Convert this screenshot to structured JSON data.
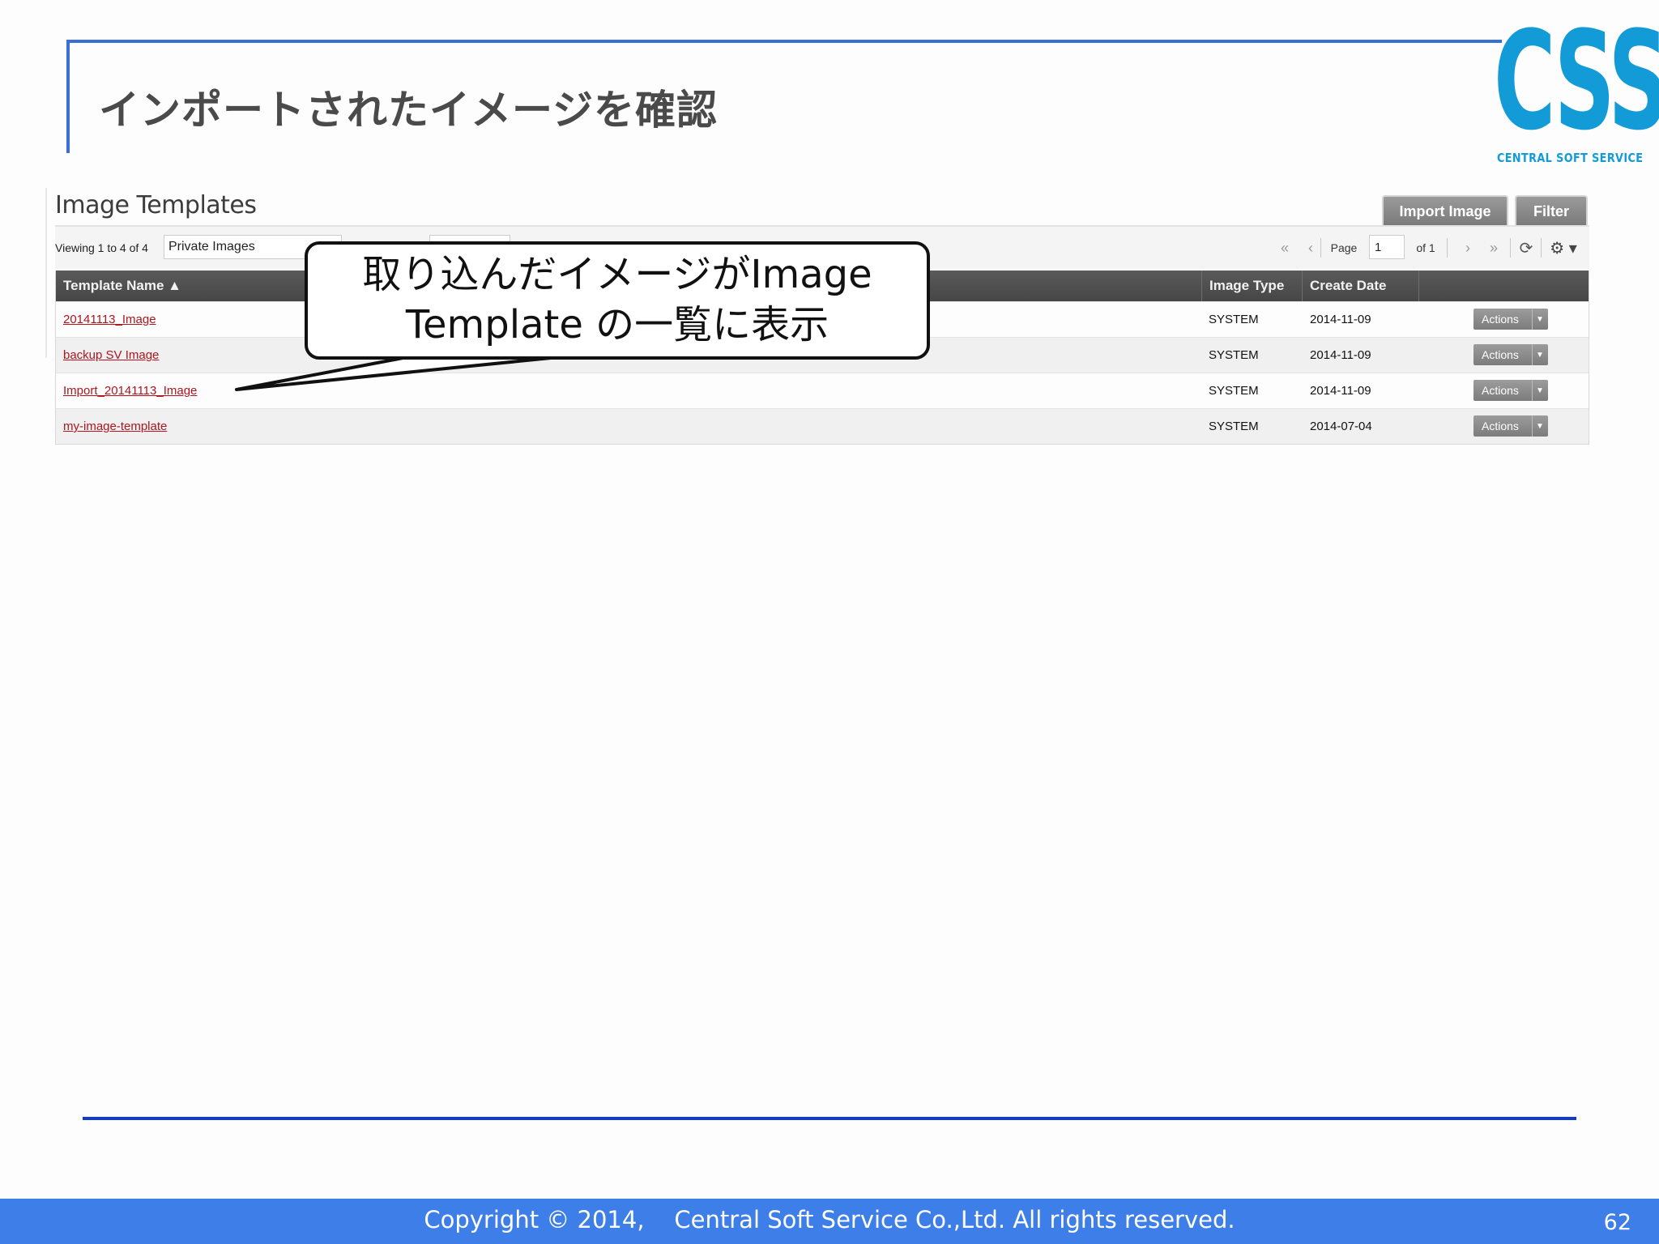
{
  "slide": {
    "title": "インポートされたイメージを確認",
    "logo_letters": "CSS",
    "logo_sub": "CENTRAL SOFT SERVICE",
    "callout_line1": "取り込んだイメージがImage",
    "callout_line2": "Template の一覧に表示",
    "copyright": "Copyright © 2014,    Central Soft Service Co.,Ltd. All rights reserved.",
    "page_number": "62"
  },
  "panel": {
    "heading": "Image Templates",
    "import_button": "Import Image",
    "filter_button": "Filter",
    "viewing_text": "Viewing 1 to 4 of 4",
    "scope_value": "Private Images",
    "pager": {
      "first_icon": "«",
      "prev_icon": "‹",
      "page_label": "Page",
      "page_value": "1",
      "of_label": "of 1",
      "next_icon": "›",
      "last_icon": "»",
      "refresh_icon": "⟳",
      "settings_icon": "⚙ ▾"
    },
    "columns": {
      "name": "Template Name ▲",
      "type": "Image Type",
      "date": "Create Date",
      "actions": ""
    },
    "rows": [
      {
        "name": "20141113_Image",
        "type": "SYSTEM",
        "date": "2014-11-09",
        "action": "Actions"
      },
      {
        "name": "backup SV Image",
        "type": "SYSTEM",
        "date": "2014-11-09",
        "action": "Actions"
      },
      {
        "name": "Import_20141113_Image",
        "type": "SYSTEM",
        "date": "2014-11-09",
        "action": "Actions"
      },
      {
        "name": "my-image-template",
        "type": "SYSTEM",
        "date": "2014-07-04",
        "action": "Actions"
      }
    ]
  },
  "colors": {
    "accent_blue": "#3a6fd8",
    "logo_blue": "#139bd8",
    "link_red": "#b0141c",
    "footer_blue": "#3d7ee8"
  }
}
